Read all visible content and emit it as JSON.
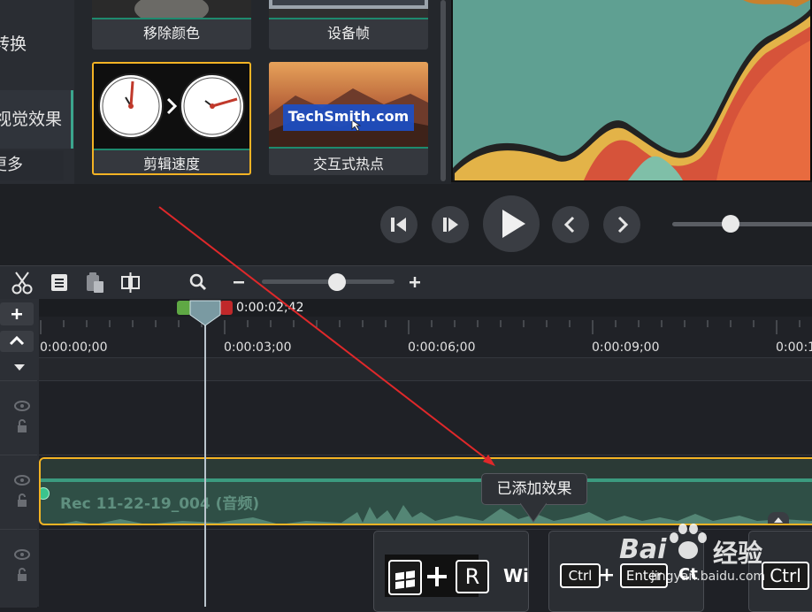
{
  "sidebar": {
    "items": [
      {
        "label": "转换"
      },
      {
        "label": "视觉效果"
      },
      {
        "label": "更多"
      }
    ]
  },
  "gallery": {
    "tiles": [
      {
        "caption": "移除颜色"
      },
      {
        "caption": "设备帧"
      },
      {
        "caption": "剪辑速度",
        "selected": true
      },
      {
        "caption": "交互式热点",
        "thumb_text": "TechSmith.com"
      }
    ]
  },
  "timeline": {
    "playhead_time": "0:00:02;42",
    "ruler_labels": [
      "0:00:00;00",
      "0:00:03;00",
      "0:00:06;00",
      "0:00:09;00",
      "0:00:1"
    ],
    "clip_label": "Rec 11-22-19_004 (音频)",
    "tooltip": "已添加效果"
  },
  "lower_clips": {
    "box1": {
      "key": "R",
      "text": "Wi"
    },
    "box2": {
      "key1": "Ctrl",
      "key2": "Enter",
      "text": "Ct"
    },
    "box3": {
      "key": "Ctrl"
    }
  },
  "watermark": {
    "brand": "Bai",
    "brand2": "经验",
    "url": "jingyan.baidu.com"
  },
  "colors": {
    "accent_yellow": "#f3b324",
    "teal": "#3ba58d",
    "annotation_arrow": "#e0282a"
  }
}
